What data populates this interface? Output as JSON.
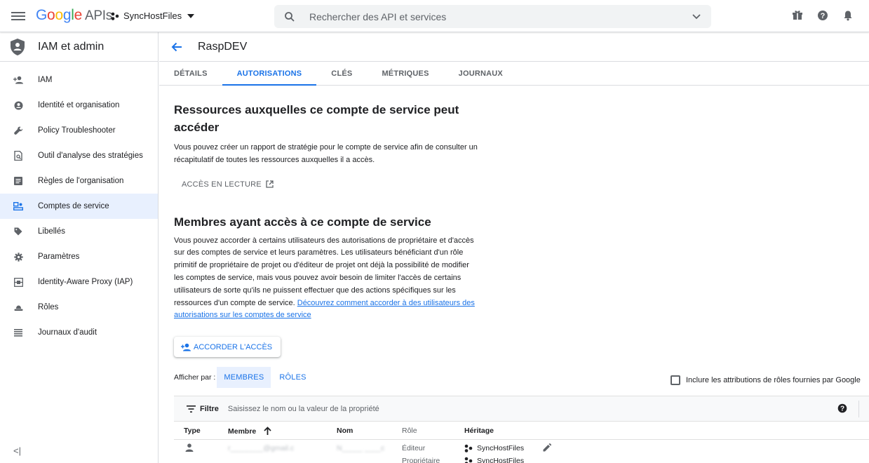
{
  "topbar": {
    "logo": {
      "g1": "G",
      "g2": "o",
      "g3": "o",
      "g4": "g",
      "g5": "l",
      "g6": "e",
      "apis": "APIs"
    },
    "project": "SyncHostFiles",
    "search_placeholder": "Rechercher des API et services"
  },
  "sidebar": {
    "title": "IAM et admin",
    "items": [
      {
        "label": "IAM",
        "icon": "person-add-icon"
      },
      {
        "label": "Identité et organisation",
        "icon": "account-circle-icon"
      },
      {
        "label": "Policy Troubleshooter",
        "icon": "wrench-icon"
      },
      {
        "label": "Outil d'analyse des stratégies",
        "icon": "policy-analyzer-icon"
      },
      {
        "label": "Règles de l'organisation",
        "icon": "list-box-icon"
      },
      {
        "label": "Comptes de service",
        "icon": "service-account-icon",
        "active": true
      },
      {
        "label": "Libellés",
        "icon": "label-tag-icon"
      },
      {
        "label": "Paramètres",
        "icon": "gear-icon"
      },
      {
        "label": "Identity-Aware Proxy (IAP)",
        "icon": "iap-icon"
      },
      {
        "label": "Rôles",
        "icon": "roles-hat-icon"
      },
      {
        "label": "Journaux d'audit",
        "icon": "audit-log-icon"
      }
    ],
    "collapse": "<|"
  },
  "page": {
    "title": "RaspDEV",
    "tabs": [
      "DÉTAILS",
      "AUTORISATIONS",
      "CLÉS",
      "MÉTRIQUES",
      "JOURNAUX"
    ],
    "active_tab": "AUTORISATIONS"
  },
  "resources": {
    "heading_line1": "Ressources auxquelles ce compte de service peut",
    "heading_line2": "accéder",
    "desc_line1": "Vous pouvez créer un rapport de stratégie pour le compte de service afin de consulter un",
    "desc_line2": "récapitulatif de toutes les ressources auxquelles il a accès.",
    "read_access": "ACCÈS EN LECTURE"
  },
  "members": {
    "heading": "Membres ayant accès à ce compte de service",
    "desc_lines": [
      "Vous pouvez accorder à certains utilisateurs des autorisations de propriétaire et d'accès",
      "sur des comptes de service et leurs paramètres. Les utilisateurs bénéficiant d'un rôle",
      "primitif de propriétaire de projet ou d'éditeur de projet ont déjà la possibilité de modifier",
      "les comptes de service, mais vous pouvez avoir besoin de limiter l'accès de certains",
      "utilisateurs de sorte qu'ils ne puissent effectuer que des actions spécifiques sur les"
    ],
    "desc_last": "ressources d'un compte de service.",
    "link_part1": "Découvrez comment accorder à des utilisateurs des",
    "link_part2": "autorisations sur les comptes de service",
    "grant_button": "ACCORDER L'ACCÈS"
  },
  "view": {
    "label": "Afficher par :",
    "members": "MEMBRES",
    "roles": "RÔLES",
    "include_label": "Inclure les attributions de rôles fournies par Google"
  },
  "filter": {
    "label": "Filtre",
    "placeholder": "Saisissez le nom ou la valeur de la propriété"
  },
  "table": {
    "headers": {
      "type": "Type",
      "member": "Membre",
      "name": "Nom",
      "role": "Rôle",
      "inheritance": "Héritage"
    },
    "row": {
      "member": "r________@gmail.c",
      "name": "N_____ ____c",
      "roles": [
        "Éditeur",
        "Propriétaire"
      ],
      "inheritance": [
        "SyncHostFiles",
        "SyncHostFiles"
      ]
    }
  },
  "colors": {
    "accent": "#1a73e8",
    "active_bg": "#e8f0fe",
    "border": "#dadce0",
    "muted": "#5f6368"
  }
}
